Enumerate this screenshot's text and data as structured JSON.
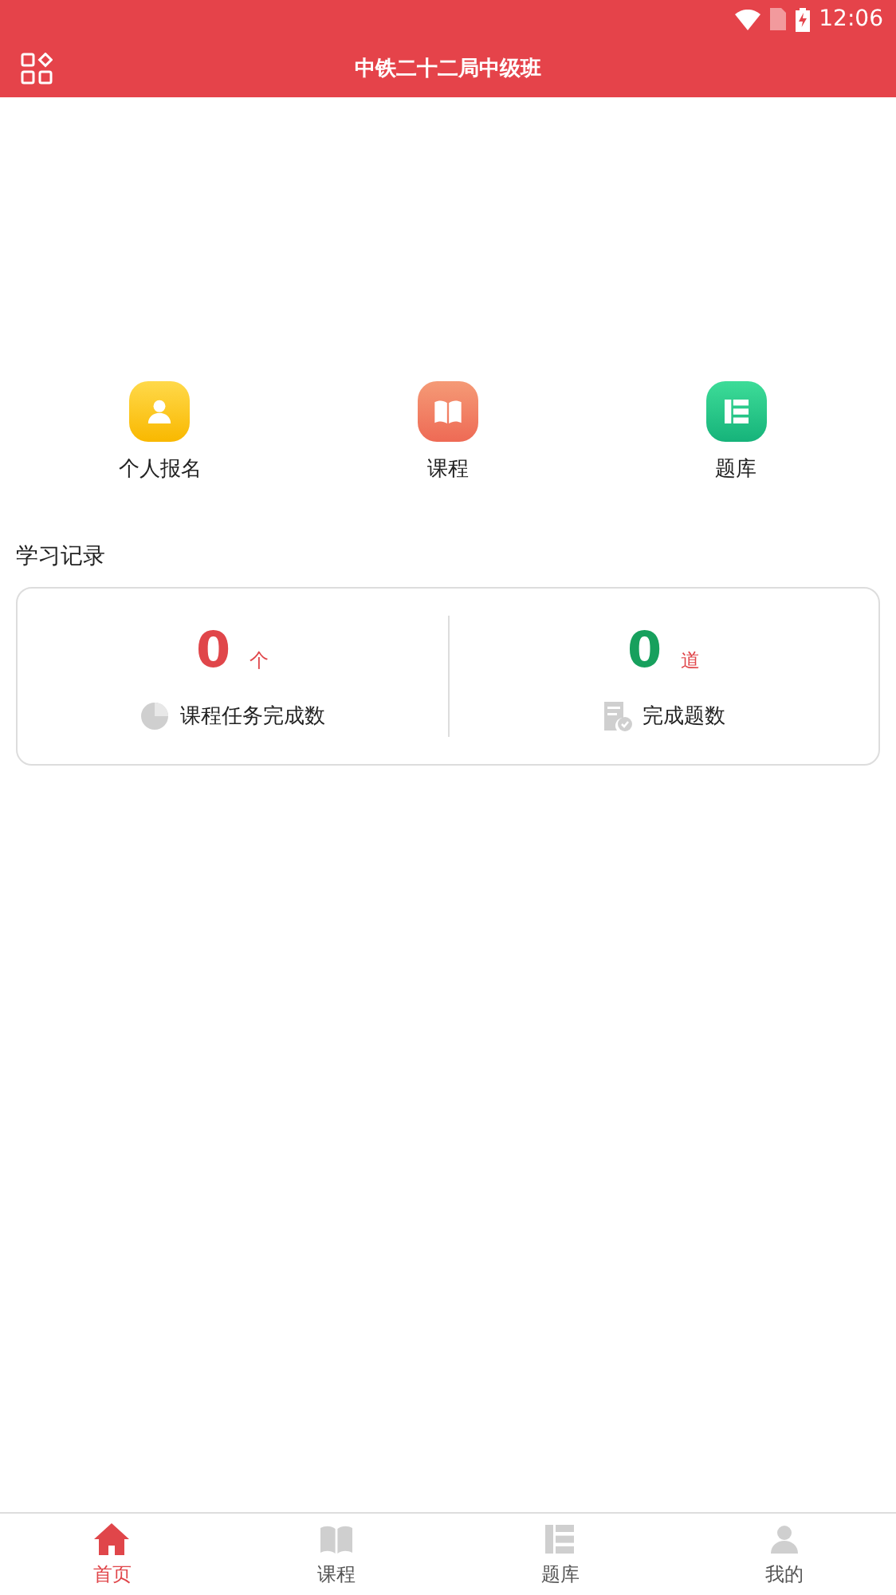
{
  "status_bar": {
    "time": "12:06"
  },
  "header": {
    "title": "中铁二十二局中级班"
  },
  "shortcuts": [
    {
      "kind": "person",
      "label": "个人报名"
    },
    {
      "kind": "book",
      "label": "课程"
    },
    {
      "kind": "list",
      "label": "题库"
    }
  ],
  "section_title": "学习记录",
  "stats": [
    {
      "kind": "pie",
      "value": "0",
      "unit": "个",
      "label": "课程任务完成数",
      "color": "#e0464a"
    },
    {
      "kind": "sheet",
      "value": "0",
      "unit": "道",
      "label": "完成题数",
      "color": "#17a05d"
    }
  ],
  "tabs": [
    {
      "kind": "home",
      "label": "首页",
      "selected": true
    },
    {
      "kind": "book",
      "label": "课程",
      "selected": false
    },
    {
      "kind": "list",
      "label": "题库",
      "selected": false
    },
    {
      "kind": "person",
      "label": "我的",
      "selected": false
    }
  ]
}
